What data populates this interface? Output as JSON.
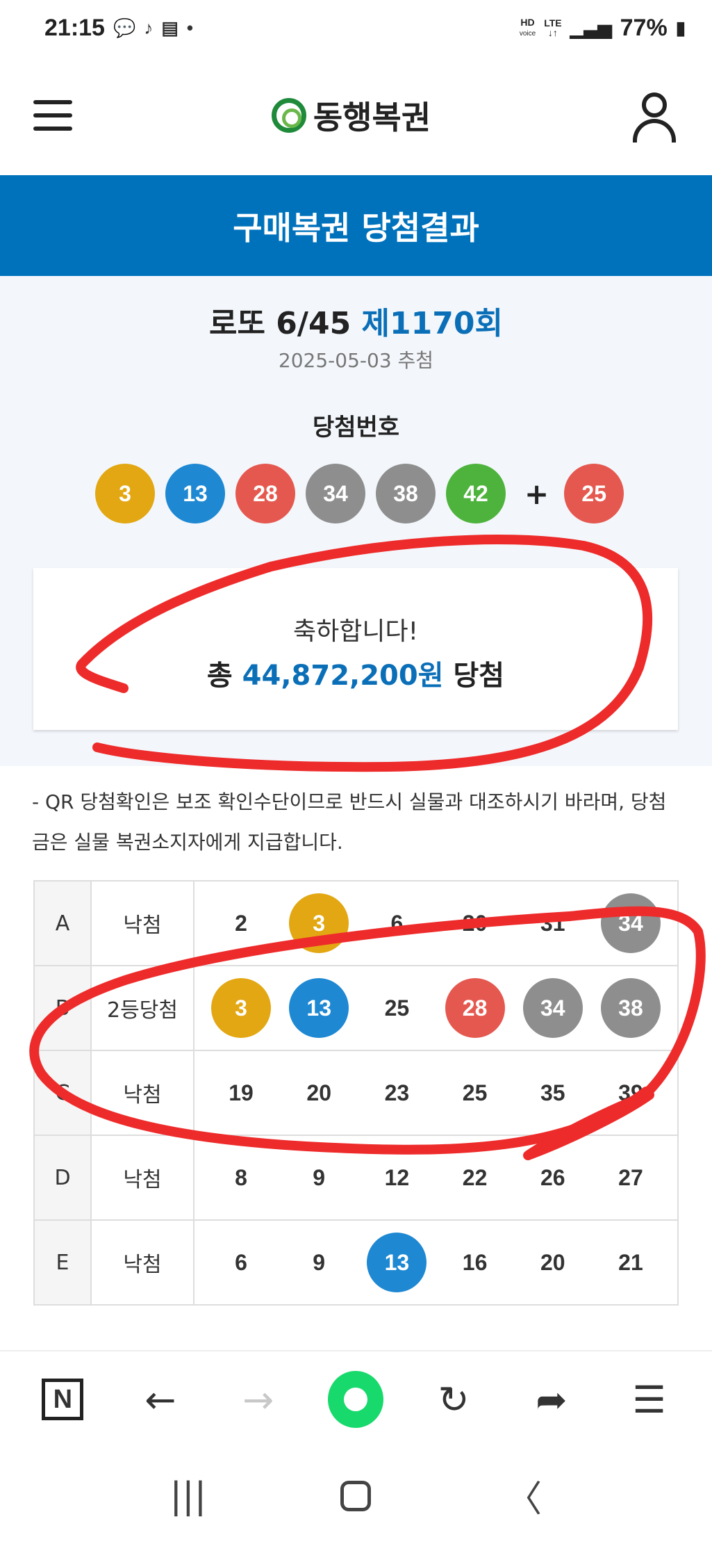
{
  "status_bar": {
    "time": "21:15",
    "icons": [
      "chat-icon",
      "tiktok-icon",
      "pdf-icon",
      "dot-icon"
    ],
    "hd_label": "HD",
    "voice_label": "voice",
    "lte_label": "LTE",
    "battery": "77%"
  },
  "header": {
    "menu_icon": "hamburger-icon",
    "logo_text": "동행복권",
    "user_icon": "user-icon"
  },
  "title_bar": {
    "title": "구매복권 당첨결과"
  },
  "result": {
    "game": "로또 6/45",
    "round": "제1170회",
    "draw_date": "2025-05-03 추첨",
    "winning_label": "당첨번호",
    "winning_numbers": [
      {
        "value": "3",
        "color": "#e2a712"
      },
      {
        "value": "13",
        "color": "#1e88d2"
      },
      {
        "value": "28",
        "color": "#e5584f"
      },
      {
        "value": "34",
        "color": "#8e8e8e"
      },
      {
        "value": "38",
        "color": "#8e8e8e"
      },
      {
        "value": "42",
        "color": "#4eb33c"
      }
    ],
    "plus": "+",
    "bonus_number": {
      "value": "25",
      "color": "#e5584f"
    },
    "congrats_line": "축하합니다!",
    "total_prefix": "총",
    "total_amount": "44,872,200원",
    "total_suffix": "당첨"
  },
  "notice": "- QR 당첨확인은 보조 확인수단이므로 반드시 실물과 대조하시기 바라며, 당첨금은 실물 복권소지자에게 지급합니다.",
  "tickets": [
    {
      "game": "A",
      "status": "낙첨",
      "numbers": [
        {
          "v": "2",
          "hit": false
        },
        {
          "v": "3",
          "hit": true,
          "color": "#e2a712"
        },
        {
          "v": "6",
          "hit": false
        },
        {
          "v": "20",
          "hit": false
        },
        {
          "v": "31",
          "hit": false
        },
        {
          "v": "34",
          "hit": true,
          "color": "#8e8e8e"
        }
      ]
    },
    {
      "game": "B",
      "status": "2등당첨",
      "numbers": [
        {
          "v": "3",
          "hit": true,
          "color": "#e2a712"
        },
        {
          "v": "13",
          "hit": true,
          "color": "#1e88d2"
        },
        {
          "v": "25",
          "hit": false
        },
        {
          "v": "28",
          "hit": true,
          "color": "#e5584f"
        },
        {
          "v": "34",
          "hit": true,
          "color": "#8e8e8e"
        },
        {
          "v": "38",
          "hit": true,
          "color": "#8e8e8e"
        }
      ]
    },
    {
      "game": "C",
      "status": "낙첨",
      "numbers": [
        {
          "v": "19",
          "hit": false
        },
        {
          "v": "20",
          "hit": false
        },
        {
          "v": "23",
          "hit": false
        },
        {
          "v": "25",
          "hit": false
        },
        {
          "v": "35",
          "hit": false
        },
        {
          "v": "39",
          "hit": false
        }
      ]
    },
    {
      "game": "D",
      "status": "낙첨",
      "numbers": [
        {
          "v": "8",
          "hit": false
        },
        {
          "v": "9",
          "hit": false
        },
        {
          "v": "12",
          "hit": false
        },
        {
          "v": "22",
          "hit": false
        },
        {
          "v": "26",
          "hit": false
        },
        {
          "v": "27",
          "hit": false
        }
      ]
    },
    {
      "game": "E",
      "status": "낙첨",
      "numbers": [
        {
          "v": "6",
          "hit": false
        },
        {
          "v": "9",
          "hit": false
        },
        {
          "v": "13",
          "hit": true,
          "color": "#1e88d2"
        },
        {
          "v": "16",
          "hit": false
        },
        {
          "v": "20",
          "hit": false
        },
        {
          "v": "21",
          "hit": false
        }
      ]
    }
  ],
  "browser_bar": {
    "n_label": "N",
    "icons": [
      "naver-icon",
      "back-arrow-icon",
      "forward-arrow-icon",
      "green-dot-icon",
      "refresh-icon",
      "share-icon",
      "menu-icon"
    ]
  },
  "nav_bar": {
    "icons": [
      "recent-apps-icon",
      "home-icon",
      "back-icon"
    ]
  },
  "annotation_color": "#ee2b2b"
}
